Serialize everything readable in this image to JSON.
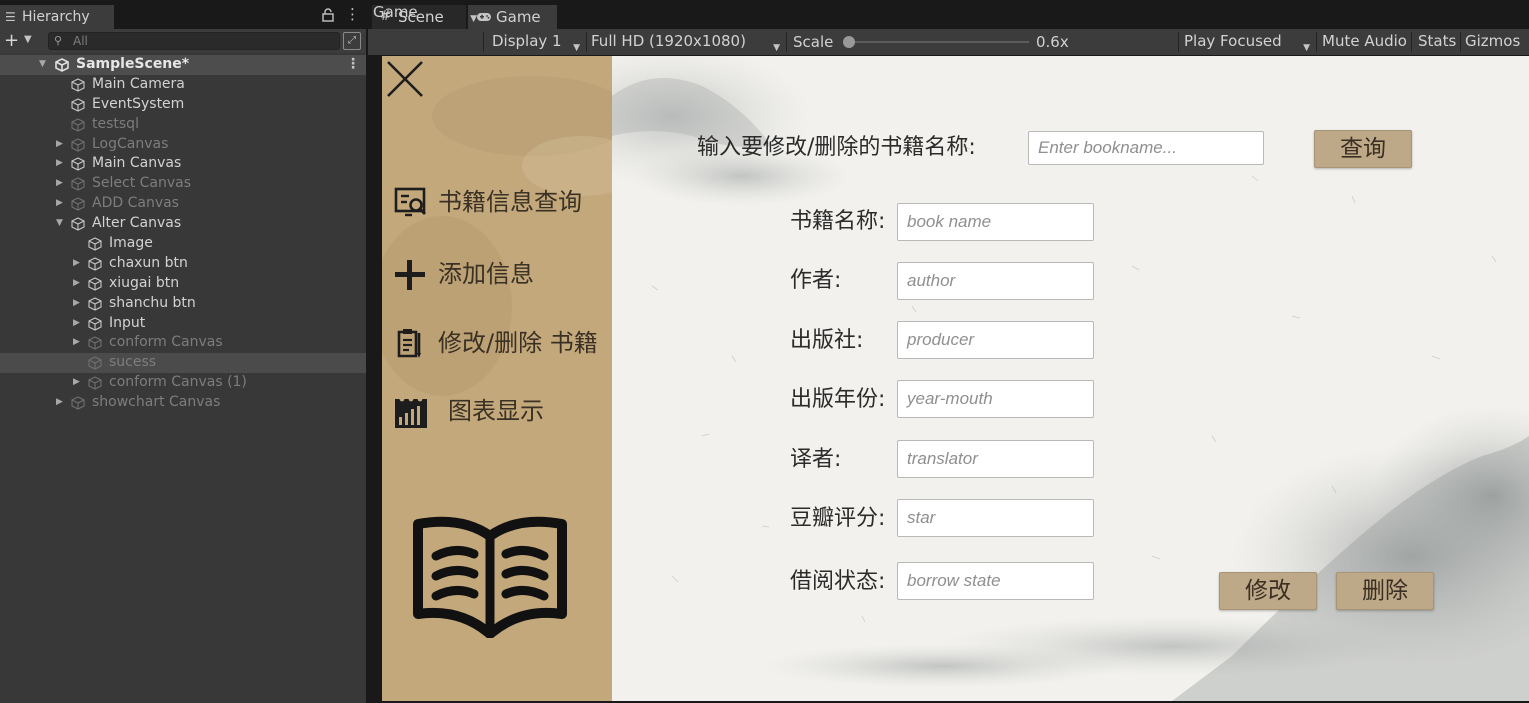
{
  "hierarchy": {
    "tab_label": "Hierarchy",
    "search_placeholder": "All",
    "scene_name": "SampleScene*",
    "items": [
      {
        "label": "Main Camera"
      },
      {
        "label": "EventSystem"
      },
      {
        "label": "testsql"
      },
      {
        "label": "LogCanvas"
      },
      {
        "label": "Main Canvas"
      },
      {
        "label": "Select Canvas"
      },
      {
        "label": "ADD Canvas"
      },
      {
        "label": "Alter Canvas"
      },
      {
        "label": "Image"
      },
      {
        "label": "chaxun btn"
      },
      {
        "label": "xiugai btn"
      },
      {
        "label": "shanchu btn"
      },
      {
        "label": "Input"
      },
      {
        "label": "conform Canvas"
      },
      {
        "label": "sucess"
      },
      {
        "label": "conform Canvas (1)"
      },
      {
        "label": "showchart Canvas"
      }
    ]
  },
  "tabs": {
    "scene_label": "Scene",
    "game_label": "Game"
  },
  "toolbar": {
    "view_mode": "Game",
    "display": "Display 1",
    "resolution": "Full HD (1920x1080)",
    "scale_label": "Scale",
    "scale_value": "0.6x",
    "play_mode": "Play Focused",
    "mute_audio": "Mute Audio",
    "stats": "Stats",
    "gizmos": "Gizmos"
  },
  "app": {
    "sidebar": {
      "menu": [
        {
          "label": "书籍信息查询",
          "icon": "search-document-icon"
        },
        {
          "label": "添加信息",
          "icon": "plus-icon"
        },
        {
          "label": "修改/删除 书籍",
          "icon": "edit-list-icon"
        },
        {
          "label": "图表显示",
          "icon": "chart-icon"
        }
      ]
    },
    "search_prompt": "输入要修改/删除的书籍名称:",
    "search_placeholder": "Enter bookname...",
    "query_button": "查询",
    "form": {
      "book_name_label": "书籍名称:",
      "book_name_placeholder": "book name",
      "author_label": "作者:",
      "author_placeholder": "author",
      "publisher_label": "出版社:",
      "publisher_placeholder": "producer",
      "year_label": "出版年份:",
      "year_placeholder": "year-mouth",
      "translator_label": "译者:",
      "translator_placeholder": "translator",
      "rating_label": "豆瓣评分:",
      "rating_placeholder": "star",
      "status_label": "借阅状态:",
      "status_placeholder": "borrow state"
    },
    "modify_button": "修改",
    "delete_button": "删除"
  }
}
